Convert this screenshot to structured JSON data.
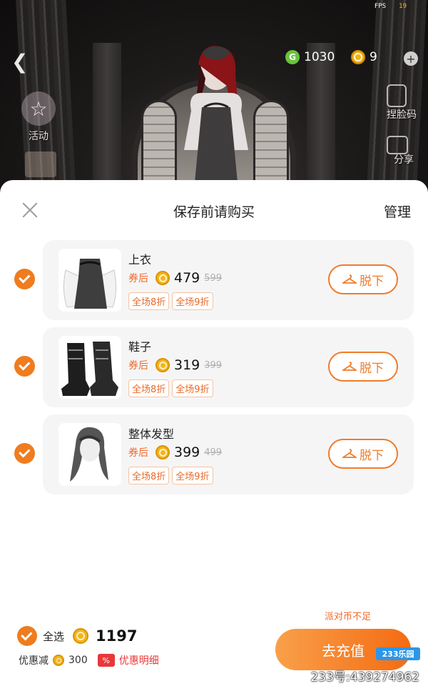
{
  "status": {
    "fps_label": "FPS",
    "fps_value": "19"
  },
  "topbar": {
    "green_coin_label": "G",
    "green_coins": "1030",
    "hex_coins": "9"
  },
  "side_buttons": {
    "activity_label": "活动",
    "pinch_face_label": "捏脸码",
    "share_label": "分享"
  },
  "sheet": {
    "title": "保存前请购买",
    "manage_label": "管理"
  },
  "items": [
    {
      "name": "上衣",
      "after_label": "券后",
      "price": "479",
      "original": "599",
      "tags": [
        "全场8折",
        "全场9折"
      ],
      "action": "脱下"
    },
    {
      "name": "鞋子",
      "after_label": "券后",
      "price": "319",
      "original": "399",
      "tags": [
        "全场8折",
        "全场9折"
      ],
      "action": "脱下"
    },
    {
      "name": "整体发型",
      "after_label": "券后",
      "price": "399",
      "original": "499",
      "tags": [
        "全场8折",
        "全场9折"
      ],
      "action": "脱下"
    }
  ],
  "footer": {
    "insufficient": "派对币不足",
    "select_all": "全选",
    "total": "1197",
    "discount_label": "优惠减",
    "discount_value": "300",
    "percent_symbol": "%",
    "detail_label": "优惠明细",
    "recharge_label": "去充值"
  },
  "watermark": {
    "logo": "233乐园",
    "text": "233号:439274962"
  },
  "colors": {
    "accent": "#ef7c1e",
    "price_red": "#f06a2c",
    "detail_red": "#e8383a"
  },
  "icons": [
    "back-arrow-icon",
    "green-coin-icon",
    "hex-coin-icon",
    "plus-icon",
    "star-icon",
    "gift-box-icon",
    "face-icon",
    "share-icon",
    "close-icon",
    "check-icon",
    "hanger-icon"
  ]
}
